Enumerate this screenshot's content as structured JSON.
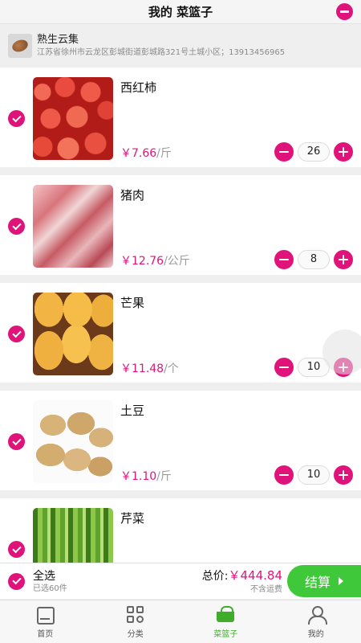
{
  "header": {
    "title": "我的 菜篮子",
    "edit_icon": "minus-circle-icon"
  },
  "store": {
    "name": "熟生云集",
    "address": "江苏省徐州市云龙区彭城街道彭城路321号土城小区；13913456965"
  },
  "items": [
    {
      "name": "西红柿",
      "price": "￥7.66",
      "unit": "/斤",
      "qty": "26",
      "image": "tomato"
    },
    {
      "name": "猪肉",
      "price": "￥12.76",
      "unit": "/公斤",
      "qty": "8",
      "image": "pork"
    },
    {
      "name": "芒果",
      "price": "￥11.48",
      "unit": "/个",
      "qty": "10",
      "image": "mango"
    },
    {
      "name": "土豆",
      "price": "￥1.10",
      "unit": "/斤",
      "qty": "10",
      "image": "potato"
    },
    {
      "name": "芹菜",
      "price": "",
      "unit": "",
      "qty": "",
      "image": "celery"
    }
  ],
  "summary": {
    "select_all": "全选",
    "selected_count": "已选60件",
    "total_label": "总价:",
    "total_amount": "￥444.84",
    "shipping_note": "不含运费",
    "checkout": "结算"
  },
  "tabs": [
    {
      "label": "首页",
      "icon": "home-icon"
    },
    {
      "label": "分类",
      "icon": "category-icon"
    },
    {
      "label": "菜篮子",
      "icon": "basket-icon"
    },
    {
      "label": "我的",
      "icon": "user-icon"
    }
  ],
  "colors": {
    "accent": "#e0137a",
    "checkout_green": "#3ec83a",
    "tab_active": "#3eae2a"
  }
}
